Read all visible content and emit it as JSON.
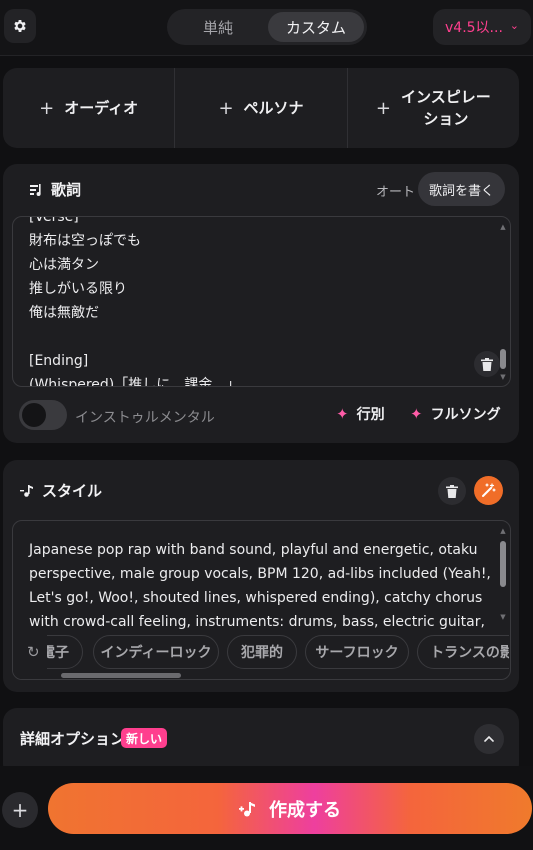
{
  "header": {
    "settings_icon": "gear-icon",
    "mode_simple": "単純",
    "mode_custom": "カスタム",
    "version": "v4.5以...",
    "version_icon": "chevron-down-icon"
  },
  "add_row": {
    "audio": "オーディオ",
    "persona": "ペルソナ",
    "inspiration": "インスピレーション",
    "inspiration_line1": "インスピレー",
    "inspiration_line2": "ション"
  },
  "lyrics": {
    "title": "歌詞",
    "auto_label": "オート",
    "write_button": "歌詞を書く",
    "text": "[Verse]\n財布は空っぽでも\n心は満タン\n推しがいる限り\n俺は無敵だ\n\n[Ending]\n(Whispered)「推しに…課金…」",
    "instrumental_label": "インストゥルメンタル",
    "instrumental_on": false,
    "by_line_button": "行別",
    "full_song_button": "フルソング"
  },
  "style": {
    "title": "スタイル",
    "text": "Japanese pop rap with band sound, playful and energetic, otaku perspective, male group vocals, BPM 120, ad-libs included (Yeah!, Let's go!, Woo!, shouted lines, whispered ending), catchy chorus with crowd-call feeling, instruments: drums, bass, electric guitar,",
    "chips": [
      "電子",
      "インディーロック",
      "犯罪的",
      "サーフロック",
      "トランスの影響"
    ]
  },
  "advanced": {
    "title": "詳細オプション",
    "badge": "新しい"
  },
  "footer": {
    "create_button": "作成する"
  },
  "colors": {
    "accent_pink": "#ff3f8e",
    "accent_orange": "#f06d28",
    "background": "#101012",
    "card": "#1e1e21"
  }
}
